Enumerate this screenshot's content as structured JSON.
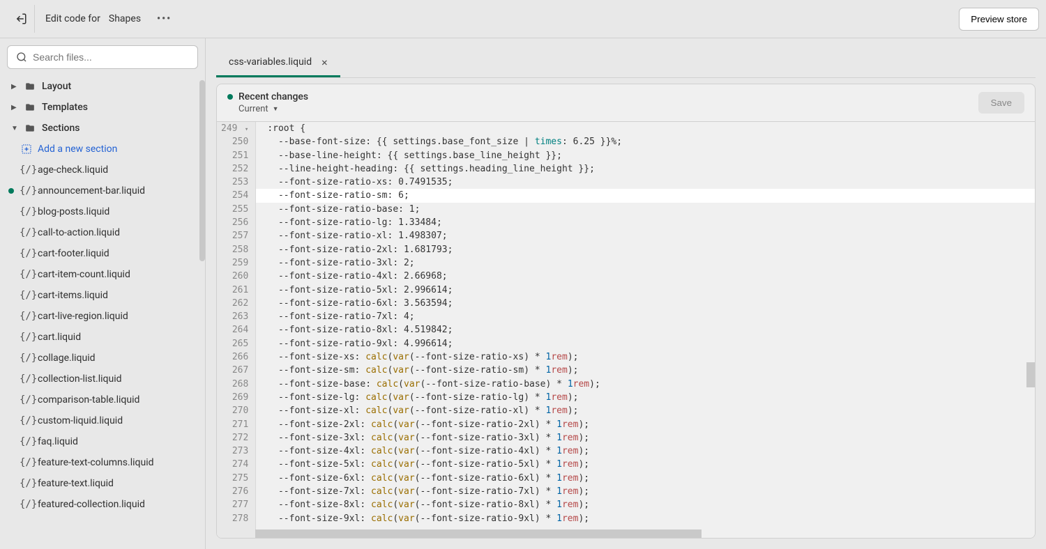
{
  "topbar": {
    "edit_label": "Edit code for",
    "theme_name": "Shapes",
    "preview_label": "Preview store"
  },
  "sidebar": {
    "search_placeholder": "Search files...",
    "folders": {
      "layout": "Layout",
      "templates": "Templates",
      "sections": "Sections"
    },
    "add_section": "Add a new section",
    "files": [
      "age-check.liquid",
      "announcement-bar.liquid",
      "blog-posts.liquid",
      "call-to-action.liquid",
      "cart-footer.liquid",
      "cart-item-count.liquid",
      "cart-items.liquid",
      "cart-live-region.liquid",
      "cart.liquid",
      "collage.liquid",
      "collection-list.liquid",
      "comparison-table.liquid",
      "custom-liquid.liquid",
      "faq.liquid",
      "feature-text-columns.liquid",
      "feature-text.liquid",
      "featured-collection.liquid"
    ]
  },
  "tab": {
    "name": "css-variables.liquid"
  },
  "editor_header": {
    "recent": "Recent changes",
    "current": "Current",
    "save": "Save"
  },
  "gutter_start": 249,
  "code": {
    "l249": ":root {",
    "l250_a": "--base-font-size: {{ settings.base_font_size | ",
    "l250_b": "times",
    "l250_c": ": 6.25 }}%;",
    "l251": "--base-line-height: {{ settings.base_line_height }};",
    "l252": "--line-height-heading: {{ settings.heading_line_height }};",
    "l253": "--font-size-ratio-xs: 0.7491535;",
    "l254": "--font-size-ratio-sm: 6;",
    "l255": "--font-size-ratio-base: 1;",
    "l256": "--font-size-ratio-lg: 1.33484;",
    "l257": "--font-size-ratio-xl: 1.498307;",
    "l258": "--font-size-ratio-2xl: 1.681793;",
    "l259": "--font-size-ratio-3xl: 2;",
    "l260": "--font-size-ratio-4xl: 2.66968;",
    "l261": "--font-size-ratio-5xl: 2.996614;",
    "l262": "--font-size-ratio-6xl: 3.563594;",
    "l263": "--font-size-ratio-7xl: 4;",
    "l264": "--font-size-ratio-8xl: 4.519842;",
    "l265": "--font-size-ratio-9xl: 4.996614;",
    "calc_prefix": "--font-size-",
    "sizes": [
      "xs",
      "sm",
      "base",
      "lg",
      "xl",
      "2xl",
      "3xl",
      "4xl",
      "5xl",
      "6xl",
      "7xl",
      "8xl",
      "9xl"
    ]
  }
}
